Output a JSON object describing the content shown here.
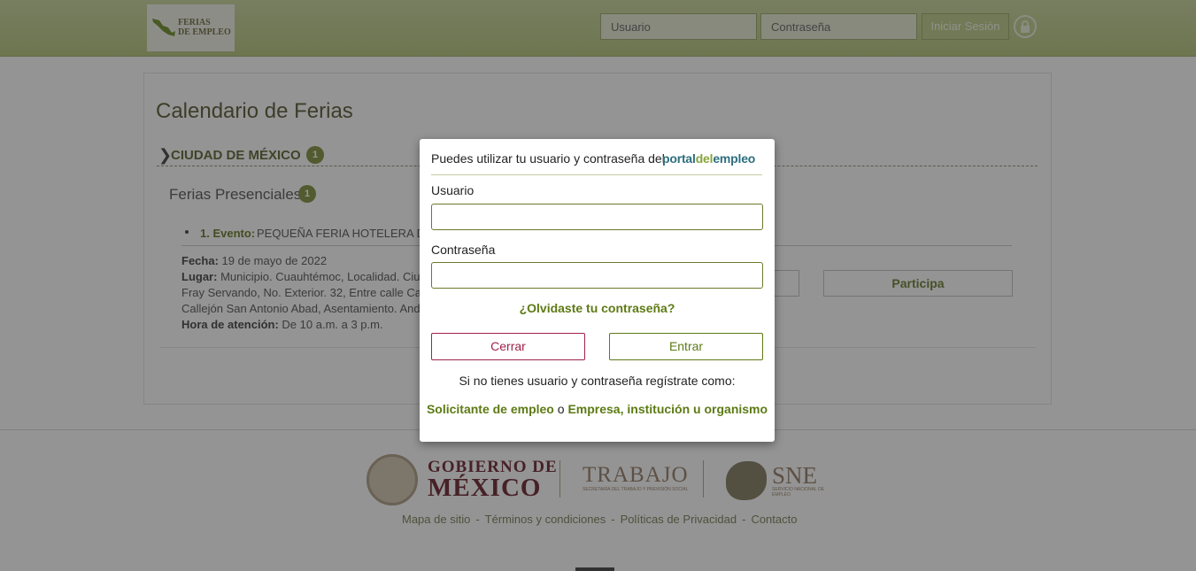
{
  "header": {
    "logo_line1": "FERIAS",
    "logo_line2": "DE EMPLEO",
    "username_placeholder": "Usuario",
    "password_placeholder": "Contraseña",
    "login_label": "Iniciar Sesión"
  },
  "main": {
    "title": "Calendario de Ferias",
    "city": {
      "name": "CIUDAD DE MÉXICO",
      "count": "1"
    },
    "section": {
      "title": "Ferias Presenciales",
      "count": "1"
    },
    "event": {
      "label": "1. Evento:",
      "name": "PEQUEÑA FERIA HOTELERA D",
      "date_label": "Fecha:",
      "date": "19 de mayo de 2022",
      "place_label": "Lugar:",
      "place_line1": "Municipio. Cuauhtémoc, Localidad. Ciud",
      "place_line2": "Fray Servando, No. Exterior. 32, Entre calle Call",
      "place_line3": "Callejón San Antonio Abad, Asentamiento. Anda",
      "hours_label": "Hora de atención:",
      "hours": "De 10 a.m. a 3 p.m.",
      "participate_label": "Participa"
    }
  },
  "footer": {
    "gob_line1": "GOBIERNO DE",
    "gob_line2": "MÉXICO",
    "trabajo": "TRABAJO",
    "trabajo_sub": "SECRETARÍA DEL TRABAJO Y PREVISIÓN SOCIAL",
    "sne": "SNE",
    "sne_sub": "SERVICIO NACIONAL DE EMPLEO",
    "links": [
      "Mapa de sitio",
      "Términos y condiciones",
      "Políticas de Privacidad",
      "Contacto"
    ]
  },
  "modal": {
    "intro": "Puedes utilizar tu usuario y contraseña del",
    "portal_part1": "portal",
    "portal_part2": "del",
    "portal_part3": "empleo",
    "username_label": "Usuario",
    "password_label": "Contraseña",
    "username_value": "",
    "password_value": "",
    "forgot": "¿Olvidaste tu contraseña?",
    "close_label": "Cerrar",
    "enter_label": "Entrar",
    "register_text": "Si no tienes usuario y contraseña regístrate como:",
    "register_seeker": "Solicitante de empleo",
    "register_or": "o",
    "register_company": "Empresa, institución u organismo"
  },
  "colors": {
    "header_green": "#c5d195",
    "accent_green": "#5d7a14",
    "close_red": "#a0234b"
  }
}
